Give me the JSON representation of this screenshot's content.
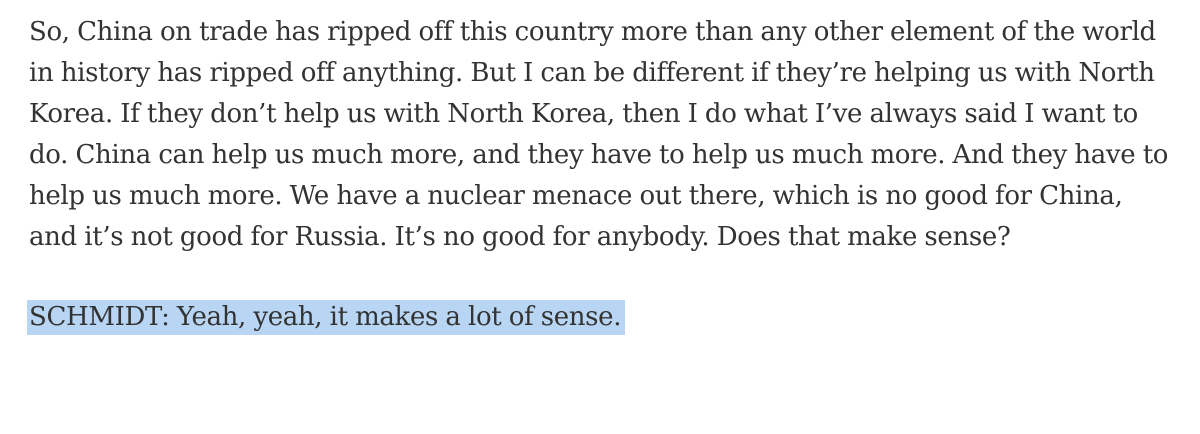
{
  "article": {
    "paragraph_1": "So, China on trade has ripped off this country more than any other element of the world in history has ripped off anything. But I can be different if they’re helping us with North Korea. If they don’t help us with North Korea, then I do what I’ve always said I want to do. China can help us much more, and they have to help us much more. And they have to help us much more. We have a nuclear menace out there, which is no good for China, and it’s not good for Russia. It’s no good for anybody. Does that make sense?",
    "paragraph_2": "SCHMIDT: Yeah, yeah, it makes a lot of sense."
  },
  "colors": {
    "text": "#333333",
    "selection_highlight": "#b8d6f3",
    "background": "#ffffff"
  }
}
